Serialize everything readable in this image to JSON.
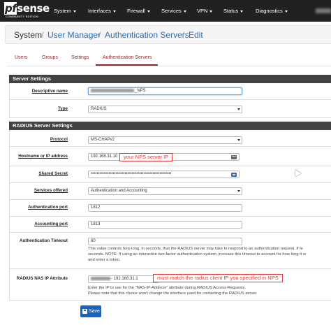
{
  "brand": {
    "logo_main": "sense",
    "logo_pf": "pf",
    "logo_sub": "COMMUNITY EDITION"
  },
  "nav": {
    "items": [
      {
        "label": "System"
      },
      {
        "label": "Interfaces"
      },
      {
        "label": "Firewall"
      },
      {
        "label": "Services"
      },
      {
        "label": "VPN"
      },
      {
        "label": "Status"
      },
      {
        "label": "Diagnostics"
      }
    ]
  },
  "breadcrumb": {
    "root": "System",
    "items": [
      "User Manager",
      "Authentication Servers",
      "Edit"
    ],
    "separator": "/"
  },
  "tabs": [
    {
      "label": "Users",
      "active": false
    },
    {
      "label": "Groups",
      "active": false
    },
    {
      "label": "Settings",
      "active": false
    },
    {
      "label": "Authentication Servers",
      "active": true
    }
  ],
  "server_settings": {
    "header": "Server Settings",
    "descriptive_name": {
      "label": "Descriptive name",
      "value_suffix": "_NPS"
    },
    "type": {
      "label": "Type",
      "value": "RADIUS"
    }
  },
  "radius_settings": {
    "header": "RADIUS Server Settings",
    "protocol": {
      "label": "Protocol",
      "value": "MS-CHAPv2"
    },
    "hostname": {
      "label": "Hostname or IP address",
      "value": "192.168.31.10"
    },
    "shared_secret": {
      "label": "Shared Secret",
      "value": "•••••••••••••••••••••••••••••••••••••••••••••••••••••••"
    },
    "services_offered": {
      "label": "Services offered",
      "value": "Authentication and Accounting"
    },
    "auth_port": {
      "label": "Authentication port",
      "value": "1812"
    },
    "acct_port": {
      "label": "Accounting port",
      "value": "1813"
    },
    "auth_timeout": {
      "label": "Authentication Timeout",
      "value": "60",
      "help_1": "This value controls how long, in seconds, that the RADIUS server may take to respond to an authentication request. If le",
      "help_2": "seconds. NOTE: If using an interactive two-factor authentication system, increase this timeout to account for how long it w",
      "help_3": "and enter a token."
    },
    "nas_ip": {
      "label": "RADIUS NAS IP Attribute",
      "value_suffix": "- 192.168.31.1",
      "help_1": "Enter the IP to use for the \"NAS-IP-Address\" attribute during RADIUS Access-Requests.",
      "help_2": "Please note that this choice won't change the interface used for contacting the RADIUS server."
    }
  },
  "annotations": {
    "nps_ip": "your NPS server IP",
    "nas_ip": "must match the radius client IP you specified in NPS"
  },
  "save_label": "Save",
  "colors": {
    "navbar": "#212121",
    "section_header": "#424242",
    "tab_active": "#8a2b2b",
    "link": "#2a6fb8",
    "annotation": "#e53935",
    "save_button": "#1565c0"
  }
}
